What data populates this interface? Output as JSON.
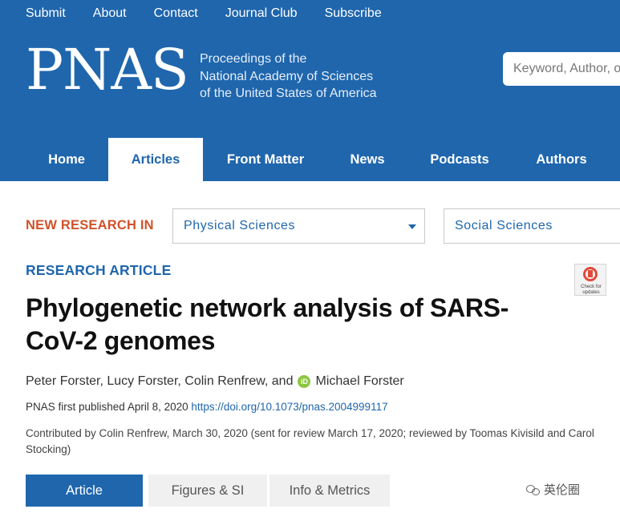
{
  "top_nav": [
    "Submit",
    "About",
    "Contact",
    "Journal Club",
    "Subscribe"
  ],
  "logo": "PNAS",
  "tagline": [
    "Proceedings of the",
    "National Academy of Sciences",
    "of the United States of America"
  ],
  "search": {
    "placeholder": "Keyword, Author, o"
  },
  "main_nav": [
    "Home",
    "Articles",
    "Front Matter",
    "News",
    "Podcasts",
    "Authors"
  ],
  "main_nav_active": "Articles",
  "new_research": {
    "label": "NEW RESEARCH IN",
    "select1": "Physical Sciences",
    "select2": "Social Sciences"
  },
  "article": {
    "kicker": "RESEARCH ARTICLE",
    "title": "Phylogenetic network analysis of SARS-CoV-2 genomes",
    "authors_before": "Peter Forster, Lucy Forster, Colin Renfrew, and",
    "author_last": "Michael Forster",
    "orcid_badge": "iD",
    "published": "PNAS first published April 8, 2020",
    "doi": "https://doi.org/10.1073/pnas.2004999117",
    "contributed": "Contributed by Colin Renfrew, March 30, 2020 (sent for review March 17, 2020; reviewed by Toomas Kivisild and Carol Stocking)"
  },
  "check_updates": "Check for updates",
  "footer_tabs": [
    "Article",
    "Figures & SI",
    "Info & Metrics"
  ],
  "footer_tab_active": "Article",
  "watermark": "英伦圈",
  "colors": {
    "brand_blue": "#1f66ad",
    "accent_orange": "#d0522b",
    "orcid_green": "#8cc63f"
  }
}
